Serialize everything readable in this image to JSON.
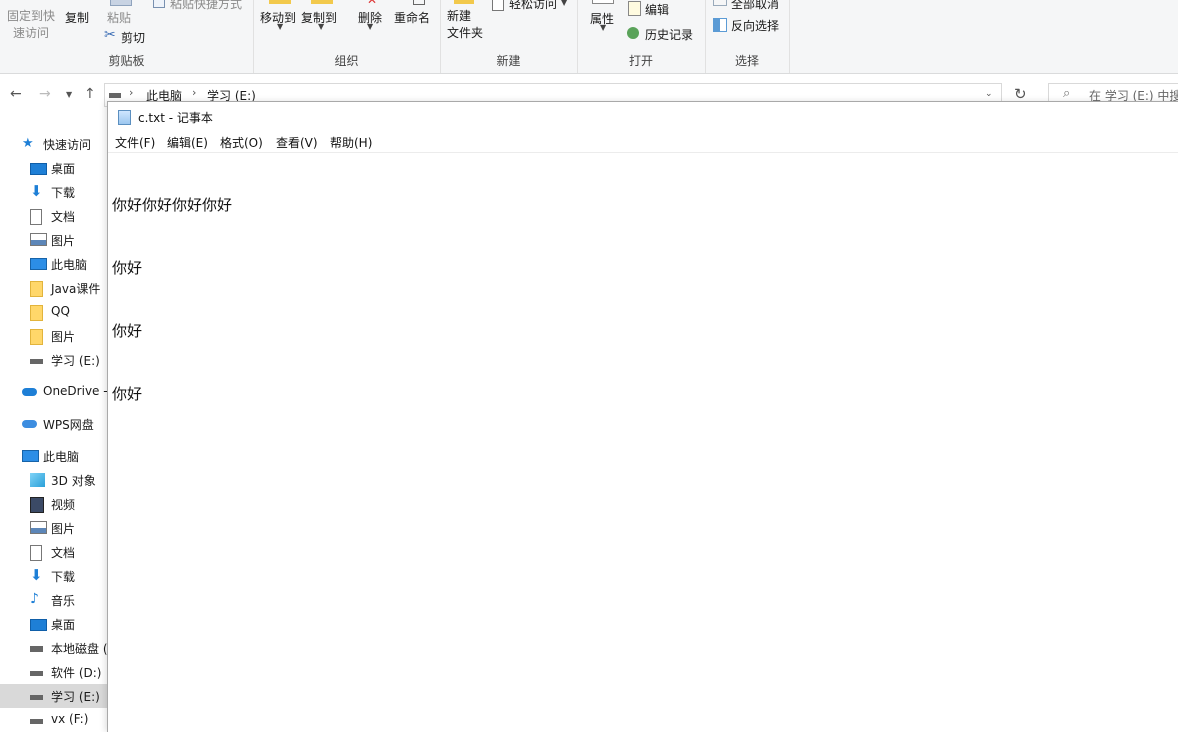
{
  "ribbon": {
    "pin_label_1": "固定到快",
    "pin_label_2": "速访问",
    "copy": "复制",
    "paste": "粘贴",
    "paste_shortcut": "粘贴快捷方式",
    "cut": "剪切",
    "clipboard": "剪贴板",
    "move_to": "移动到",
    "copy_to": "复制到",
    "delete": "删除",
    "rename": "重命名",
    "organize": "组织",
    "new_folder_1": "新建",
    "new_folder_2": "文件夹",
    "easy_access": "轻松访问",
    "new": "新建",
    "properties": "属性",
    "edit": "编辑",
    "history": "历史记录",
    "open": "打开",
    "select_none": "全部取消",
    "invert_selection": "反向选择",
    "select": "选择"
  },
  "address": {
    "crumb_1": "此电脑",
    "crumb_2": "学习 (E:)",
    "search_placeholder": "在 学习 (E:) 中搜"
  },
  "sidebar": {
    "items": [
      {
        "label": "快速访问",
        "icon": "star-icon"
      },
      {
        "label": "桌面",
        "icon": "desktop-icon"
      },
      {
        "label": "下载",
        "icon": "download-icon"
      },
      {
        "label": "文档",
        "icon": "document-icon"
      },
      {
        "label": "图片",
        "icon": "picture-icon"
      },
      {
        "label": "此电脑",
        "icon": "computer-icon"
      },
      {
        "label": "Java课件",
        "icon": "folder-icon"
      },
      {
        "label": "QQ",
        "icon": "folder-icon"
      },
      {
        "label": "图片",
        "icon": "folder-icon"
      },
      {
        "label": "学习 (E:)",
        "icon": "drive-icon"
      },
      {
        "label": "OneDrive -",
        "icon": "onedrive-icon"
      },
      {
        "label": "WPS网盘",
        "icon": "wps-cloud-icon"
      },
      {
        "label": "此电脑",
        "icon": "computer-icon"
      },
      {
        "label": "3D 对象",
        "icon": "3d-objects-icon"
      },
      {
        "label": "视频",
        "icon": "video-icon"
      },
      {
        "label": "图片",
        "icon": "picture-icon"
      },
      {
        "label": "文档",
        "icon": "document-icon"
      },
      {
        "label": "下载",
        "icon": "download-icon"
      },
      {
        "label": "音乐",
        "icon": "music-icon"
      },
      {
        "label": "桌面",
        "icon": "desktop-icon"
      },
      {
        "label": "本地磁盘 (",
        "icon": "local-disk-icon"
      },
      {
        "label": "软件 (D:)",
        "icon": "drive-icon"
      },
      {
        "label": "学习 (E:)",
        "icon": "drive-icon"
      },
      {
        "label": "vx (F:)",
        "icon": "drive-icon"
      }
    ]
  },
  "notepad": {
    "title": "c.txt - 记事本",
    "menu": [
      "文件(F)",
      "编辑(E)",
      "格式(O)",
      "查看(V)",
      "帮助(H)"
    ],
    "lines": [
      "你好你好你好你好",
      "你好",
      "你好",
      "你好"
    ]
  },
  "colors": {
    "accent": "#1e7fd6",
    "selection": "#d9d9d9",
    "folder": "#ffd76a"
  }
}
